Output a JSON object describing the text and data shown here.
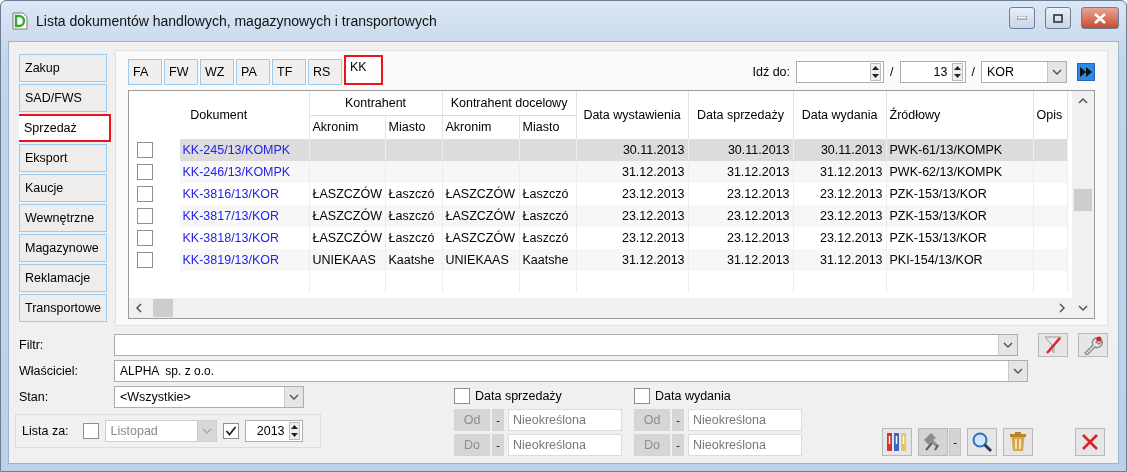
{
  "window": {
    "title": "Lista dokumentów handlowych, magazynowych i transportowych"
  },
  "sidebar": {
    "items": [
      {
        "label": "Zakup",
        "selected": false
      },
      {
        "label": "SAD/FWS",
        "selected": false
      },
      {
        "label": "Sprzedaż",
        "selected": true
      },
      {
        "label": "Eksport",
        "selected": false
      },
      {
        "label": "Kaucje",
        "selected": false
      },
      {
        "label": "Wewnętrzne",
        "selected": false
      },
      {
        "label": "Magazynowe",
        "selected": false
      },
      {
        "label": "Reklamacje",
        "selected": false
      },
      {
        "label": "Transportowe",
        "selected": false
      }
    ]
  },
  "doc_tabs": [
    {
      "label": "FA",
      "selected": false
    },
    {
      "label": "FW",
      "selected": false
    },
    {
      "label": "WZ",
      "selected": false
    },
    {
      "label": "PA",
      "selected": false
    },
    {
      "label": "TF",
      "selected": false
    },
    {
      "label": "RS",
      "selected": false
    },
    {
      "label": "KK",
      "selected": true
    }
  ],
  "goto": {
    "label": "Idź do:",
    "separator_1": "/",
    "year": "13",
    "separator_2": "/",
    "series": "KOR"
  },
  "table": {
    "headers": {
      "document": "Dokument",
      "contractor": "Kontrahent",
      "target_contractor": "Kontrahent docelowy",
      "acronym": "Akronim",
      "city": "Miasto",
      "target_acronym": "Akronim",
      "target_city": "Miasto",
      "issue_date": "Data wystawienia",
      "sale_date": "Data sprzedaży",
      "release_date": "Data wydania",
      "source": "Źródłowy",
      "description": "Opis"
    },
    "rows": [
      {
        "checked": false,
        "selected": true,
        "document": "KK-245/13/KOMPK",
        "issue_date": "30.11.2013",
        "sale_date": "30.11.2013",
        "release_date": "30.11.2013",
        "source": "PWK-61/13/KOMPK"
      },
      {
        "checked": false,
        "selected": false,
        "document": "KK-246/13/KOMPK",
        "issue_date": "31.12.2013",
        "sale_date": "31.12.2013",
        "release_date": "31.12.2013",
        "source": "PWK-62/13/KOMPK"
      },
      {
        "checked": false,
        "selected": false,
        "document": "KK-3816/13/KOR",
        "acronym": "ŁASZCZÓW",
        "city": "Łaszczó",
        "target_acronym": "ŁASZCZÓW",
        "target_city": "Łaszczó",
        "issue_date": "23.12.2013",
        "sale_date": "23.12.2013",
        "release_date": "23.12.2013",
        "source": "PZK-153/13/KOR"
      },
      {
        "checked": false,
        "selected": false,
        "document": "KK-3817/13/KOR",
        "acronym": "ŁASZCZÓW",
        "city": "Łaszczó",
        "target_acronym": "ŁASZCZÓW",
        "target_city": "Łaszczó",
        "issue_date": "23.12.2013",
        "sale_date": "23.12.2013",
        "release_date": "23.12.2013",
        "source": "PZK-153/13/KOR"
      },
      {
        "checked": false,
        "selected": false,
        "document": "KK-3818/13/KOR",
        "acronym": "ŁASZCZÓW",
        "city": "Łaszczó",
        "target_acronym": "ŁASZCZÓW",
        "target_city": "Łaszczó",
        "issue_date": "23.12.2013",
        "sale_date": "23.12.2013",
        "release_date": "23.12.2013",
        "source": "PZK-153/13/KOR"
      },
      {
        "checked": false,
        "selected": false,
        "document": "KK-3819/13/KOR",
        "acronym": "UNIEKAAS",
        "city": "Kaatshe",
        "target_acronym": "UNIEKAAS",
        "target_city": "Kaatshe",
        "issue_date": "31.12.2013",
        "sale_date": "31.12.2013",
        "release_date": "31.12.2013",
        "source": "PKI-154/13/KOR"
      }
    ]
  },
  "filter": {
    "label": "Filtr:"
  },
  "owner": {
    "label": "Właściciel:",
    "value": "ALPHA  sp. z o.o."
  },
  "state": {
    "label": "Stan:",
    "value": "<Wszystkie>"
  },
  "list_for": {
    "label": "Lista za:",
    "month_checked": false,
    "month": "Listopad",
    "year_checked": true,
    "year": "2013"
  },
  "date_filters": [
    {
      "label": "Data sprzedaży",
      "checked": false,
      "ranges": [
        {
          "button": "Od",
          "disabled": true,
          "dropdown": "-",
          "placeholder": "Nieokreślona"
        },
        {
          "button": "Do",
          "disabled": true,
          "dropdown": "-",
          "placeholder": "Nieokreślona"
        }
      ]
    },
    {
      "label": "Data wydania",
      "checked": false,
      "ranges": [
        {
          "button": "Od",
          "disabled": true,
          "dropdown": "-",
          "placeholder": "Nieokreślona"
        },
        {
          "button": "Do",
          "disabled": true,
          "dropdown": "-",
          "placeholder": "Nieokreślona"
        }
      ]
    }
  ],
  "actions": [
    {
      "kind": "binders",
      "disabled": false
    },
    {
      "kind": "tools",
      "disabled": true,
      "dropdown": "-"
    },
    {
      "kind": "search",
      "disabled": false
    },
    {
      "kind": "trash",
      "disabled": false
    }
  ]
}
